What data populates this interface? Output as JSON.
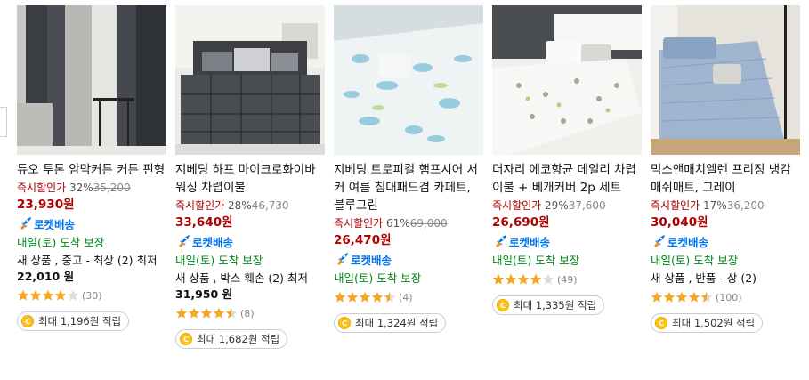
{
  "products": [
    {
      "name": "듀오 투톤 암막커튼 커튼 핀형",
      "discount_label": "즉시할인가",
      "discount_pct": "32%",
      "original_price": "35,200",
      "price": "23,930원",
      "rocket": "로켓배송",
      "delivery": "내일(토) 도착 보장",
      "other_offer": "새 상품 , 중고 - 최상 (2) 최저",
      "other_price": "22,010 원",
      "rating": 4.0,
      "review_count": "(30)",
      "cashback": "최대 1,196원 적립"
    },
    {
      "name": "지베딩 하프 마이크로화이바 워싱 차렵이불",
      "discount_label": "즉시할인가",
      "discount_pct": "28%",
      "original_price": "46,730",
      "price": "33,640원",
      "rocket": "로켓배송",
      "delivery": "내일(토) 도착 보장",
      "other_offer": "새 상품 , 박스 훼손 (2) 최저",
      "other_price": "31,950 원",
      "rating": 4.5,
      "review_count": "(8)",
      "cashback": "최대 1,682원 적립"
    },
    {
      "name": "지베딩 트로피컬 햄프시어 서커 여름 침대패드겸 카페트, 블루그린",
      "discount_label": "즉시할인가",
      "discount_pct": "61%",
      "original_price": "69,000",
      "price": "26,470원",
      "rocket": "로켓배송",
      "delivery": "내일(토) 도착 보장",
      "other_offer": "",
      "other_price": "",
      "rating": 4.5,
      "review_count": "(4)",
      "cashback": "최대 1,324원 적립"
    },
    {
      "name": "더자리 에코항균 데일리 차렵이불 + 베개커버 2p 세트",
      "discount_label": "즉시할인가",
      "discount_pct": "29%",
      "original_price": "37,600",
      "price": "26,690원",
      "rocket": "로켓배송",
      "delivery": "내일(토) 도착 보장",
      "other_offer": "",
      "other_price": "",
      "rating": 4.0,
      "review_count": "(49)",
      "cashback": "최대 1,335원 적립"
    },
    {
      "name": "믹스앤매치엘렌 프리징 냉감 매쉬매트, 그레이",
      "discount_label": "즉시할인가",
      "discount_pct": "17%",
      "original_price": "36,200",
      "price": "30,040원",
      "rocket": "로켓배송",
      "delivery": "내일(토) 도착 보장",
      "other_offer": "새 상품 , 반품 - 상 (2)",
      "other_price": "",
      "rating": 4.5,
      "review_count": "(100)",
      "cashback": "최대 1,502원 적립"
    }
  ],
  "colors": {
    "discount_red": "#ae0000",
    "rocket_blue": "#0073e9",
    "delivery_green": "#00891a",
    "star_orange": "#f5a623",
    "coin_yellow": "#f9c51c"
  },
  "icons": {
    "rocket": "rocket-icon",
    "star": "star-icon",
    "coin": "coin-icon"
  }
}
